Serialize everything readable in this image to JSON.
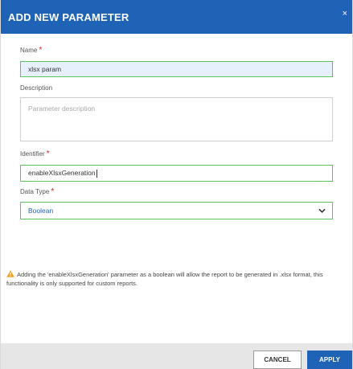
{
  "dialog": {
    "title": "ADD NEW PARAMETER",
    "close_glyph": "×"
  },
  "form": {
    "name": {
      "label": "Name",
      "required_mark": "*",
      "value": "xlsx param"
    },
    "description": {
      "label": "Description",
      "placeholder": "Parameter description",
      "value": ""
    },
    "identifier": {
      "label": "Identifier",
      "required_mark": "*",
      "value": "enableXlsxGeneration"
    },
    "data_type": {
      "label": "Data Type",
      "required_mark": "*",
      "selected": "Boolean"
    }
  },
  "notice": {
    "icon": "warning-icon",
    "text": "Adding the 'enableXlsxGeneration' parameter as a boolean will allow the report to be generated in .xlsx format, this functionality is only supported for custom reports."
  },
  "footer": {
    "cancel_label": "CANCEL",
    "apply_label": "APPLY"
  },
  "colors": {
    "header": "#1f63b6",
    "required": "#e0211b",
    "valid_border": "#5cc45c",
    "warning": "#f0a020",
    "footer": "#e6e6e6"
  }
}
